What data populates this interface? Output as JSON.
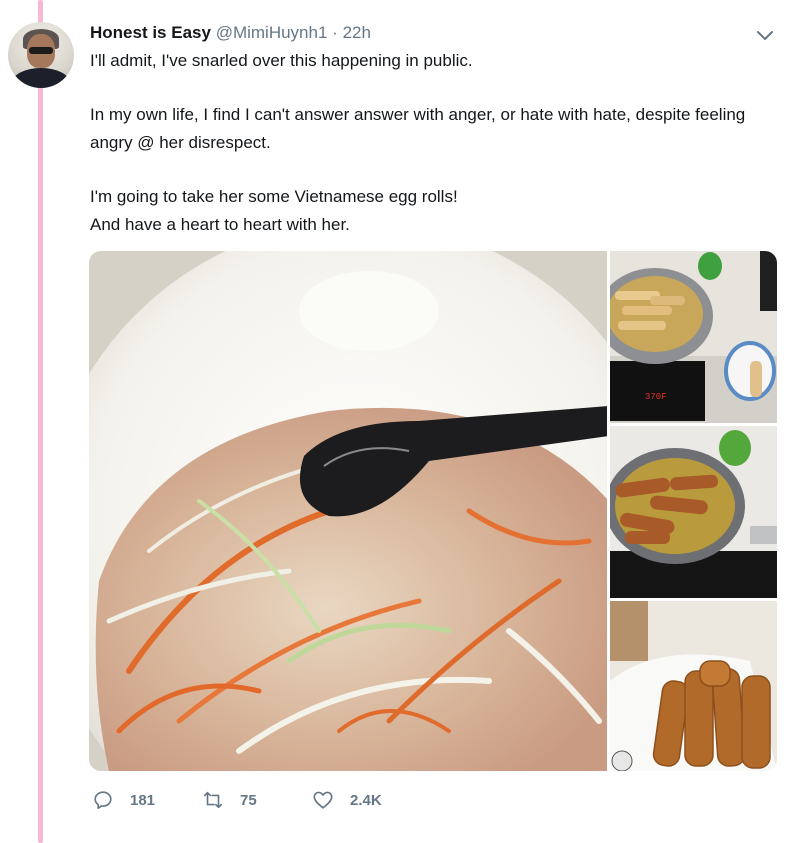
{
  "tweet": {
    "author_name": "Honest is Easy",
    "handle": "@MimiHuynh1",
    "separator": "·",
    "time": "22h",
    "paragraphs": [
      "I'll admit, I've snarled over this happening in public.",
      "In my own life, I find I can't answer answer with anger, or hate with hate, despite feeling angry @ her disrespect.",
      "I'm going to take her some Vietnamese egg rolls!",
      "And have a heart to heart with her."
    ],
    "stove_display": "370F"
  },
  "actions": {
    "replies": "181",
    "retweets": "75",
    "likes": "2.4K"
  },
  "colors": {
    "thread_line": "#f7b8d3",
    "secondary_text": "#657786",
    "primary_text": "#14171a"
  },
  "icons": {
    "reply": "reply-icon",
    "retweet": "retweet-icon",
    "like": "heart-icon",
    "menu": "chevron-down-icon"
  }
}
